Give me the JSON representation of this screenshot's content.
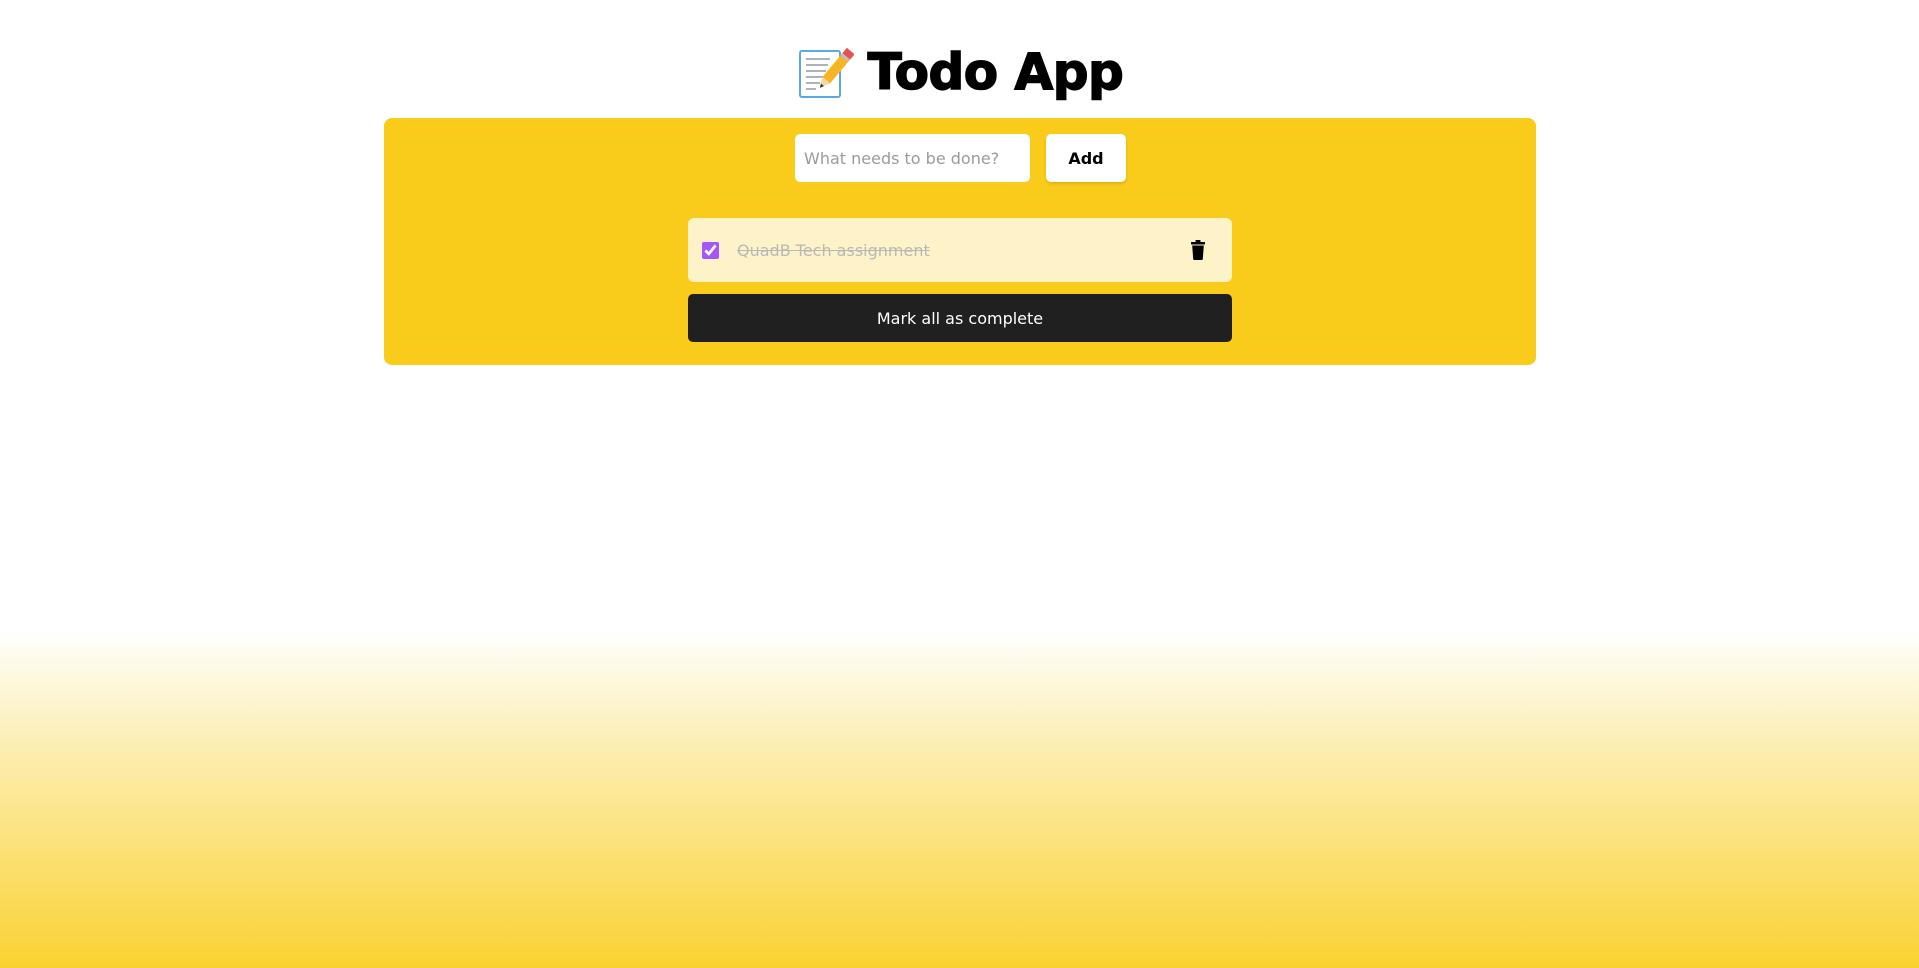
{
  "header": {
    "icon": "memo-icon",
    "title": "Todo App"
  },
  "form": {
    "input_value": "",
    "input_placeholder": "What needs to be done?",
    "add_label": "Add"
  },
  "todos": [
    {
      "text": "QuadB Tech assignment",
      "completed": true,
      "delete_icon": "trash-icon"
    }
  ],
  "actions": {
    "mark_all_label": "Mark all as complete"
  },
  "colors": {
    "panel": "#f9cb1a",
    "todo_item": "#fef3c8",
    "checkbox_accent": "#a855f7",
    "mark_all_button": "#202020"
  }
}
